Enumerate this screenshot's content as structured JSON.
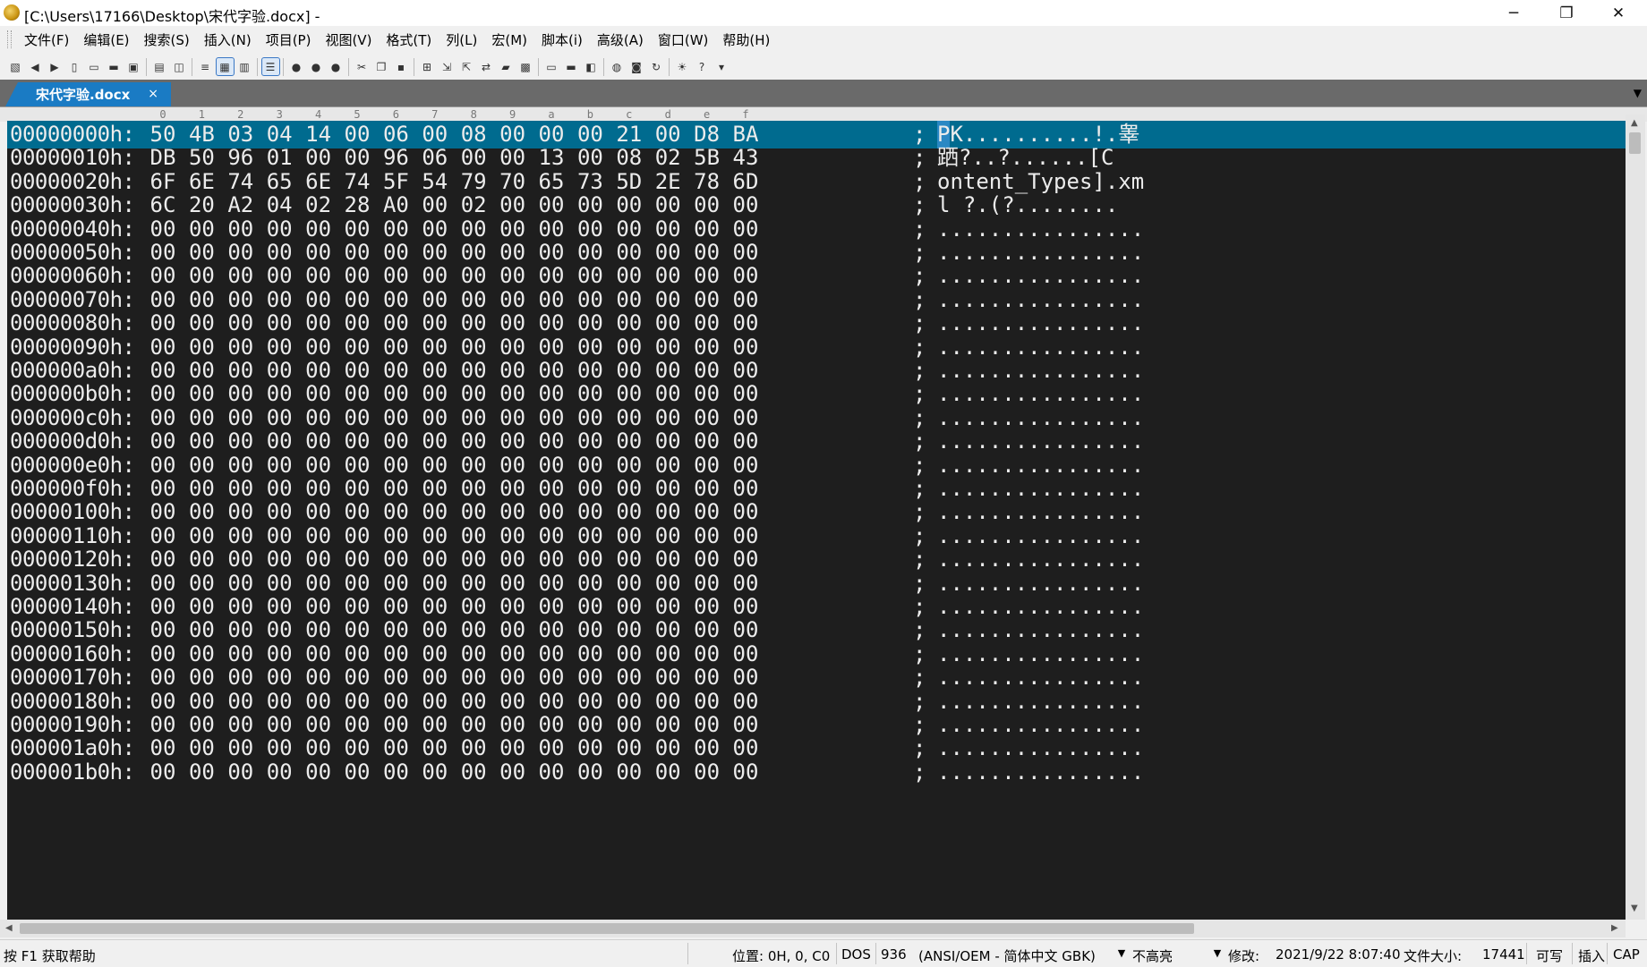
{
  "window": {
    "title": "[C:\\Users\\17166\\Desktop\\宋代字验.docx] -",
    "minimize_label": "─",
    "restore_label": "❐",
    "close_label": "✕"
  },
  "menu": [
    "文件(F)",
    "编辑(E)",
    "搜索(S)",
    "插入(N)",
    "项目(P)",
    "视图(V)",
    "格式(T)",
    "列(L)",
    "宏(M)",
    "脚本(i)",
    "高级(A)",
    "窗口(W)",
    "帮助(H)"
  ],
  "toolbar": [
    {
      "name": "new-project-icon",
      "glyph": "▧"
    },
    {
      "name": "back-icon",
      "glyph": "◀"
    },
    {
      "name": "forward-icon",
      "glyph": "▶"
    },
    {
      "name": "new-file-icon",
      "glyph": "▯"
    },
    {
      "name": "open-icon",
      "glyph": "▭"
    },
    {
      "name": "open-folder-icon",
      "glyph": "▬"
    },
    {
      "name": "close-file-icon",
      "glyph": "▣"
    },
    {
      "sep": true
    },
    {
      "name": "print-icon",
      "glyph": "▤"
    },
    {
      "name": "print-preview-icon",
      "glyph": "◫"
    },
    {
      "sep": true
    },
    {
      "name": "word-wrap-icon",
      "glyph": "≡"
    },
    {
      "name": "hex-mode-icon",
      "glyph": "▦",
      "selected": true
    },
    {
      "name": "column-mode-icon",
      "glyph": "▥"
    },
    {
      "sep": true
    },
    {
      "name": "list-lines-icon",
      "glyph": "☰",
      "selected": true
    },
    {
      "sep": true
    },
    {
      "name": "macro-record-icon",
      "glyph": "●"
    },
    {
      "name": "macro-play-icon",
      "glyph": "●"
    },
    {
      "name": "macro-stop-icon",
      "glyph": "●"
    },
    {
      "sep": true
    },
    {
      "name": "cut-icon",
      "glyph": "✂"
    },
    {
      "name": "copy-icon",
      "glyph": "❐"
    },
    {
      "name": "paste-icon",
      "glyph": "▪"
    },
    {
      "sep": true
    },
    {
      "name": "find-icon",
      "glyph": "⊞"
    },
    {
      "name": "find-next-icon",
      "glyph": "⇲"
    },
    {
      "name": "find-prev-icon",
      "glyph": "⇱"
    },
    {
      "name": "replace-icon",
      "glyph": "⇄"
    },
    {
      "name": "find-in-files-icon",
      "glyph": "▰"
    },
    {
      "name": "replace-in-files-icon",
      "glyph": "▩"
    },
    {
      "sep": true
    },
    {
      "name": "window-cascade-icon",
      "glyph": "▭"
    },
    {
      "name": "window-tile-icon",
      "glyph": "▬"
    },
    {
      "name": "window-arrange-icon",
      "glyph": "◧"
    },
    {
      "sep": true
    },
    {
      "name": "browser-icon",
      "glyph": "◍"
    },
    {
      "name": "screenshot-icon",
      "glyph": "◙"
    },
    {
      "name": "refresh-icon",
      "glyph": "↻"
    },
    {
      "sep": true
    },
    {
      "name": "tip-icon",
      "glyph": "☀"
    },
    {
      "name": "help-icon",
      "glyph": "?"
    },
    {
      "name": "toolbar-overflow-icon",
      "glyph": "▾"
    }
  ],
  "tab": {
    "label": "宋代字验.docx",
    "close_label": "×"
  },
  "tab_scroll_label": "▼",
  "ruler": [
    "0",
    "1",
    "2",
    "3",
    "4",
    "5",
    "6",
    "7",
    "8",
    "9",
    "a",
    "b",
    "c",
    "d",
    "e",
    "f"
  ],
  "hex_rows": [
    {
      "offset": "00000000h:",
      "bytes": [
        "50",
        "4B",
        "03",
        "04",
        "14",
        "00",
        "06",
        "00",
        "08",
        "00",
        "00",
        "00",
        "21",
        "00",
        "D8",
        "BA"
      ],
      "ascii": "PK..........!.睾"
    },
    {
      "offset": "00000010h:",
      "bytes": [
        "DB",
        "50",
        "96",
        "01",
        "00",
        "00",
        "96",
        "06",
        "00",
        "00",
        "13",
        "00",
        "08",
        "02",
        "5B",
        "43"
      ],
      "ascii": "跴?..?......[C"
    },
    {
      "offset": "00000020h:",
      "bytes": [
        "6F",
        "6E",
        "74",
        "65",
        "6E",
        "74",
        "5F",
        "54",
        "79",
        "70",
        "65",
        "73",
        "5D",
        "2E",
        "78",
        "6D"
      ],
      "ascii": "ontent_Types].xm"
    },
    {
      "offset": "00000030h:",
      "bytes": [
        "6C",
        "20",
        "A2",
        "04",
        "02",
        "28",
        "A0",
        "00",
        "02",
        "00",
        "00",
        "00",
        "00",
        "00",
        "00",
        "00"
      ],
      "ascii": "l ?.(?........"
    },
    {
      "offset": "00000040h:",
      "bytes": [
        "00",
        "00",
        "00",
        "00",
        "00",
        "00",
        "00",
        "00",
        "00",
        "00",
        "00",
        "00",
        "00",
        "00",
        "00",
        "00"
      ],
      "ascii": "................"
    },
    {
      "offset": "00000050h:",
      "bytes": [
        "00",
        "00",
        "00",
        "00",
        "00",
        "00",
        "00",
        "00",
        "00",
        "00",
        "00",
        "00",
        "00",
        "00",
        "00",
        "00"
      ],
      "ascii": "................"
    },
    {
      "offset": "00000060h:",
      "bytes": [
        "00",
        "00",
        "00",
        "00",
        "00",
        "00",
        "00",
        "00",
        "00",
        "00",
        "00",
        "00",
        "00",
        "00",
        "00",
        "00"
      ],
      "ascii": "................"
    },
    {
      "offset": "00000070h:",
      "bytes": [
        "00",
        "00",
        "00",
        "00",
        "00",
        "00",
        "00",
        "00",
        "00",
        "00",
        "00",
        "00",
        "00",
        "00",
        "00",
        "00"
      ],
      "ascii": "................"
    },
    {
      "offset": "00000080h:",
      "bytes": [
        "00",
        "00",
        "00",
        "00",
        "00",
        "00",
        "00",
        "00",
        "00",
        "00",
        "00",
        "00",
        "00",
        "00",
        "00",
        "00"
      ],
      "ascii": "................"
    },
    {
      "offset": "00000090h:",
      "bytes": [
        "00",
        "00",
        "00",
        "00",
        "00",
        "00",
        "00",
        "00",
        "00",
        "00",
        "00",
        "00",
        "00",
        "00",
        "00",
        "00"
      ],
      "ascii": "................"
    },
    {
      "offset": "000000a0h:",
      "bytes": [
        "00",
        "00",
        "00",
        "00",
        "00",
        "00",
        "00",
        "00",
        "00",
        "00",
        "00",
        "00",
        "00",
        "00",
        "00",
        "00"
      ],
      "ascii": "................"
    },
    {
      "offset": "000000b0h:",
      "bytes": [
        "00",
        "00",
        "00",
        "00",
        "00",
        "00",
        "00",
        "00",
        "00",
        "00",
        "00",
        "00",
        "00",
        "00",
        "00",
        "00"
      ],
      "ascii": "................"
    },
    {
      "offset": "000000c0h:",
      "bytes": [
        "00",
        "00",
        "00",
        "00",
        "00",
        "00",
        "00",
        "00",
        "00",
        "00",
        "00",
        "00",
        "00",
        "00",
        "00",
        "00"
      ],
      "ascii": "................"
    },
    {
      "offset": "000000d0h:",
      "bytes": [
        "00",
        "00",
        "00",
        "00",
        "00",
        "00",
        "00",
        "00",
        "00",
        "00",
        "00",
        "00",
        "00",
        "00",
        "00",
        "00"
      ],
      "ascii": "................"
    },
    {
      "offset": "000000e0h:",
      "bytes": [
        "00",
        "00",
        "00",
        "00",
        "00",
        "00",
        "00",
        "00",
        "00",
        "00",
        "00",
        "00",
        "00",
        "00",
        "00",
        "00"
      ],
      "ascii": "................"
    },
    {
      "offset": "000000f0h:",
      "bytes": [
        "00",
        "00",
        "00",
        "00",
        "00",
        "00",
        "00",
        "00",
        "00",
        "00",
        "00",
        "00",
        "00",
        "00",
        "00",
        "00"
      ],
      "ascii": "................"
    },
    {
      "offset": "00000100h:",
      "bytes": [
        "00",
        "00",
        "00",
        "00",
        "00",
        "00",
        "00",
        "00",
        "00",
        "00",
        "00",
        "00",
        "00",
        "00",
        "00",
        "00"
      ],
      "ascii": "................"
    },
    {
      "offset": "00000110h:",
      "bytes": [
        "00",
        "00",
        "00",
        "00",
        "00",
        "00",
        "00",
        "00",
        "00",
        "00",
        "00",
        "00",
        "00",
        "00",
        "00",
        "00"
      ],
      "ascii": "................"
    },
    {
      "offset": "00000120h:",
      "bytes": [
        "00",
        "00",
        "00",
        "00",
        "00",
        "00",
        "00",
        "00",
        "00",
        "00",
        "00",
        "00",
        "00",
        "00",
        "00",
        "00"
      ],
      "ascii": "................"
    },
    {
      "offset": "00000130h:",
      "bytes": [
        "00",
        "00",
        "00",
        "00",
        "00",
        "00",
        "00",
        "00",
        "00",
        "00",
        "00",
        "00",
        "00",
        "00",
        "00",
        "00"
      ],
      "ascii": "................"
    },
    {
      "offset": "00000140h:",
      "bytes": [
        "00",
        "00",
        "00",
        "00",
        "00",
        "00",
        "00",
        "00",
        "00",
        "00",
        "00",
        "00",
        "00",
        "00",
        "00",
        "00"
      ],
      "ascii": "................"
    },
    {
      "offset": "00000150h:",
      "bytes": [
        "00",
        "00",
        "00",
        "00",
        "00",
        "00",
        "00",
        "00",
        "00",
        "00",
        "00",
        "00",
        "00",
        "00",
        "00",
        "00"
      ],
      "ascii": "................"
    },
    {
      "offset": "00000160h:",
      "bytes": [
        "00",
        "00",
        "00",
        "00",
        "00",
        "00",
        "00",
        "00",
        "00",
        "00",
        "00",
        "00",
        "00",
        "00",
        "00",
        "00"
      ],
      "ascii": "................"
    },
    {
      "offset": "00000170h:",
      "bytes": [
        "00",
        "00",
        "00",
        "00",
        "00",
        "00",
        "00",
        "00",
        "00",
        "00",
        "00",
        "00",
        "00",
        "00",
        "00",
        "00"
      ],
      "ascii": "................"
    },
    {
      "offset": "00000180h:",
      "bytes": [
        "00",
        "00",
        "00",
        "00",
        "00",
        "00",
        "00",
        "00",
        "00",
        "00",
        "00",
        "00",
        "00",
        "00",
        "00",
        "00"
      ],
      "ascii": "................"
    },
    {
      "offset": "00000190h:",
      "bytes": [
        "00",
        "00",
        "00",
        "00",
        "00",
        "00",
        "00",
        "00",
        "00",
        "00",
        "00",
        "00",
        "00",
        "00",
        "00",
        "00"
      ],
      "ascii": "................"
    },
    {
      "offset": "000001a0h:",
      "bytes": [
        "00",
        "00",
        "00",
        "00",
        "00",
        "00",
        "00",
        "00",
        "00",
        "00",
        "00",
        "00",
        "00",
        "00",
        "00",
        "00"
      ],
      "ascii": "................"
    },
    {
      "offset": "000001b0h:",
      "bytes": [
        "00",
        "00",
        "00",
        "00",
        "00",
        "00",
        "00",
        "00",
        "00",
        "00",
        "00",
        "00",
        "00",
        "00",
        "00",
        "00"
      ],
      "ascii": "................"
    }
  ],
  "separator": ";",
  "selected_row": 0,
  "colors": {
    "editor_background": "#1e1e1e",
    "editor_text": "#ececec",
    "selected_row": "#006b8f",
    "tab_active": "#1a7bc4",
    "tabstrip": "#6a6a6a"
  },
  "status": {
    "help": "按 F1 获取帮助",
    "position": "位置: 0H, 0, C0",
    "line_ending": "DOS",
    "codepage_num": "936",
    "codepage": "(ANSI/OEM - 简体中文 GBK)",
    "highlight": "不高亮",
    "modified": "修改:",
    "modified_time": "2021/9/22 8:07:40",
    "filesize_label": "文件大小:",
    "filesize": "17441",
    "writable": "可写",
    "insert": "插入",
    "caps": "CAP"
  }
}
